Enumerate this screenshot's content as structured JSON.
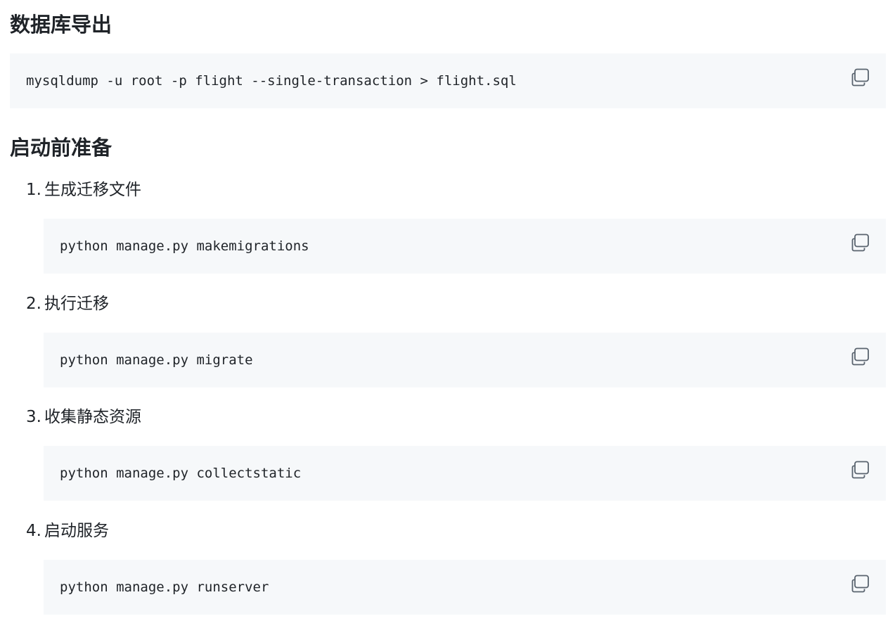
{
  "sections": {
    "export": {
      "heading": "数据库导出",
      "command": "mysqldump -u root -p flight --single-transaction > flight.sql"
    },
    "prep": {
      "heading": "启动前准备",
      "steps": [
        {
          "number": "1.",
          "label": "生成迁移文件",
          "command": "python manage.py makemigrations"
        },
        {
          "number": "2.",
          "label": "执行迁移",
          "command": "python manage.py migrate"
        },
        {
          "number": "3.",
          "label": "收集静态资源",
          "command": "python manage.py collectstatic"
        },
        {
          "number": "4.",
          "label": "启动服务",
          "command": "python manage.py runserver"
        }
      ]
    }
  },
  "icons": {
    "copy": "copy-icon"
  },
  "colors": {
    "code_bg": "#f6f8fa",
    "text": "#1f2328",
    "icon": "#59636e"
  }
}
